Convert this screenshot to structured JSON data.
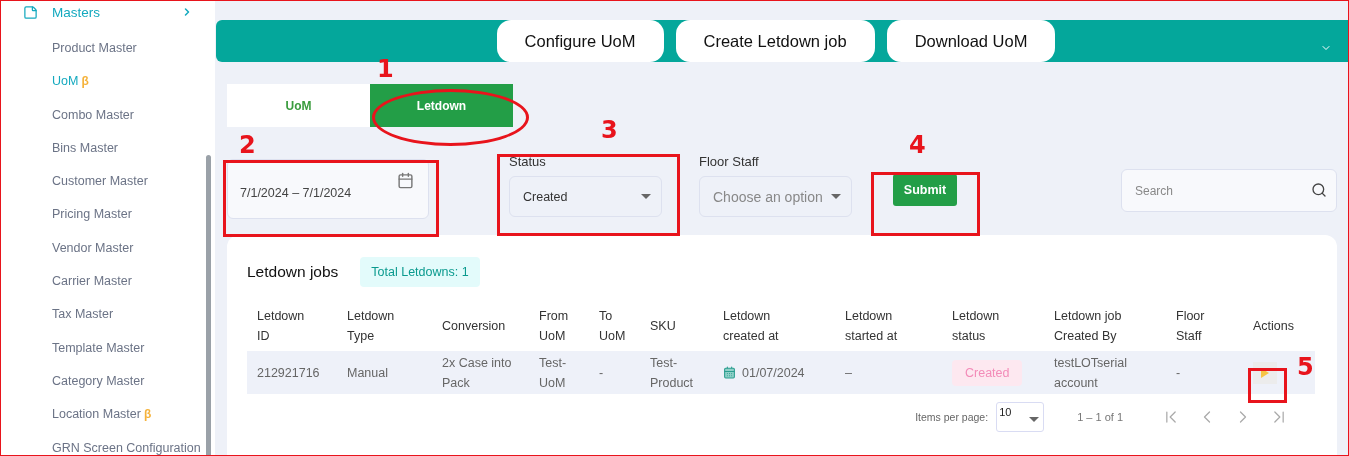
{
  "sidebar": {
    "section": {
      "label": "Masters",
      "expanded": true
    },
    "items": [
      {
        "label": "Product Master",
        "selected": false
      },
      {
        "label": "UoM",
        "badge": "β",
        "selected": true
      },
      {
        "label": "Combo Master",
        "selected": false
      },
      {
        "label": "Bins Master",
        "selected": false
      },
      {
        "label": "Customer Master",
        "selected": false
      },
      {
        "label": "Pricing Master",
        "selected": false
      },
      {
        "label": "Vendor Master",
        "selected": false
      },
      {
        "label": "Carrier Master",
        "selected": false
      },
      {
        "label": "Tax Master",
        "selected": false
      },
      {
        "label": "Template Master",
        "selected": false
      },
      {
        "label": "Category Master",
        "selected": false
      },
      {
        "label": "Location Master",
        "badge": "β",
        "selected": false
      },
      {
        "label": "GRN Screen Configuration",
        "selected": false
      }
    ]
  },
  "header": {
    "buttons": [
      "Configure UoM",
      "Create Letdown job",
      "Download UoM"
    ]
  },
  "tabs": [
    {
      "label": "UoM",
      "selected": false
    },
    {
      "label": "Letdown",
      "selected": true
    }
  ],
  "filters": {
    "date_range": {
      "value": "7/1/2024 – 7/1/2024"
    },
    "status": {
      "label": "Status",
      "value": "Created"
    },
    "floor_staff": {
      "label": "Floor Staff",
      "placeholder": "Choose an option"
    },
    "submit": "Submit",
    "search": {
      "placeholder": "Search"
    }
  },
  "table": {
    "title": "Letdown jobs",
    "total": "Total Letdowns: 1",
    "columns": [
      "Letdown ID",
      "Letdown Type",
      "Conversion",
      "From UoM",
      "To UoM",
      "SKU",
      "Letdown created at",
      "Letdown started at",
      "Letdown status",
      "Letdown job Created By",
      "Floor Staff",
      "Actions"
    ],
    "rows": [
      {
        "id": "212921716",
        "type": "Manual",
        "conversion": "2x Case into Pack",
        "from_uom": "Test-UoM",
        "to_uom": "-",
        "sku": "Test-Product",
        "created_at": "01/07/2024",
        "started_at": "–",
        "status": "Created",
        "created_by": "testLOTserial account",
        "floor_staff": "-"
      }
    ]
  },
  "pagination": {
    "items_per_page_label": "Items per page:",
    "items_per_page": "10",
    "range": "1 – 1 of 1"
  },
  "annotations": [
    {
      "label": "1",
      "kind": "ellipse"
    },
    {
      "label": "2",
      "kind": "rect"
    },
    {
      "label": "3",
      "kind": "rect"
    },
    {
      "label": "4",
      "kind": "rect"
    },
    {
      "label": "5",
      "kind": "rect"
    }
  ]
}
